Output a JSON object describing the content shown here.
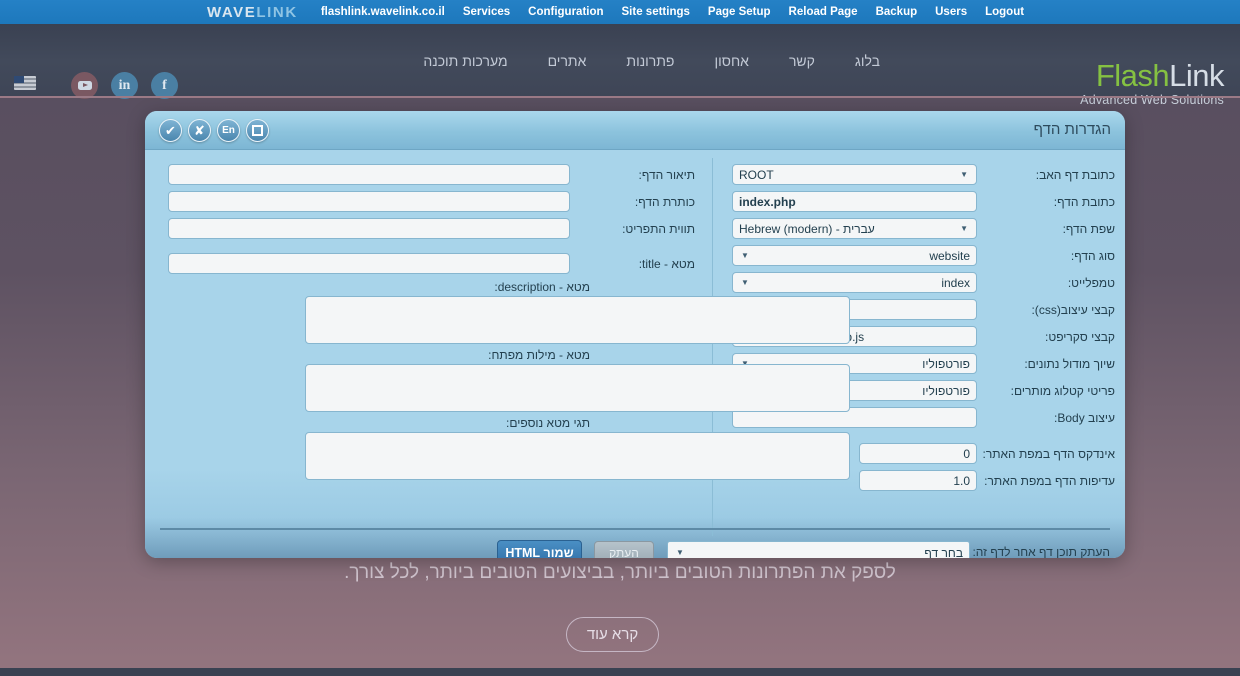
{
  "admin_bar": {
    "logo_part1": "WAVE",
    "logo_part2": "LINK",
    "domain": "flashlink.wavelink.co.il",
    "links": [
      {
        "label": "Services"
      },
      {
        "label": "Configuration"
      },
      {
        "label": "Site settings"
      },
      {
        "label": "Page Setup"
      },
      {
        "label": "Reload Page"
      },
      {
        "label": "Backup"
      },
      {
        "label": "Users"
      },
      {
        "label": "Logout"
      }
    ],
    "bg_color": "#2079be"
  },
  "site_header": {
    "icons": [
      {
        "name": "us-flag-icon"
      },
      {
        "name": "youtube-icon"
      },
      {
        "name": "linkedin-icon",
        "glyph": "in"
      },
      {
        "name": "facebook-icon",
        "glyph": "f"
      }
    ],
    "nav_items": [
      {
        "label": "מערכות תוכנה"
      },
      {
        "label": "אתרים"
      },
      {
        "label": "פתרונות"
      },
      {
        "label": "אחסון"
      },
      {
        "label": "קשר"
      },
      {
        "label": "בלוג"
      }
    ],
    "logo": {
      "part1": "Flash",
      "part2": "Link",
      "tagline": "Advanced Web Solutions",
      "part1_color": "#85c142",
      "part2_color": "#d6dde6"
    }
  },
  "panel": {
    "title": "הגדרות הדף",
    "toolbar": [
      {
        "name": "confirm-button",
        "glyph": "✔"
      },
      {
        "name": "cancel-button",
        "glyph": "✘"
      },
      {
        "name": "language-button",
        "glyph": "En"
      },
      {
        "name": "expand-button",
        "glyph": ""
      }
    ],
    "left_column": {
      "page_description_label": "תיאור הדף:",
      "page_description_value": "",
      "page_heading_label": "כותרת הדף:",
      "page_heading_value": "",
      "menu_label_label": "תווית התפריט:",
      "menu_label_value": "",
      "meta_title_label": "מטא - title:",
      "meta_title_value": "",
      "meta_description_label": "מטא - description:",
      "meta_description_value": "",
      "meta_keywords_label": "מטא - מילות מפתח:",
      "meta_keywords_value": "",
      "extra_meta_label": "תגי מטא נוספים:",
      "extra_meta_value": ""
    },
    "right_column": {
      "parent_page_label": "כתובת דף האב:",
      "parent_page_value": "ROOT",
      "page_address_label": "כתובת הדף:",
      "page_address_value": "index.php",
      "page_language_label": "שפת הדף:",
      "page_language_value": "Hebrew (modern) - עברית",
      "page_type_label": "סוג הדף:",
      "page_type_value": "website",
      "template_label": "טמפלייט:",
      "template_value": "index",
      "css_files_label": "קבצי עיצוב(css):",
      "css_files_value": "",
      "script_files_label": "קבצי סקריפט:",
      "script_files_value": "scripts/jquery.knob.js",
      "data_module_label": "שיוך מודול נתונים:",
      "data_module_value": "פורטפוליו",
      "catalog_items_label": "פריטי קטלוג מותרים:",
      "catalog_items_value": "פורטפוליו",
      "body_style_label": "עיצוב Body:",
      "body_style_value": "",
      "sitemap_index_label": "אינדקס הדף במפת האתר:",
      "sitemap_index_value": "0",
      "sitemap_priority_label": "עדיפות הדף במפת האתר:",
      "sitemap_priority_value": "1.0"
    },
    "actions": {
      "copy_from_page_label": "העתק תוכן דף אחר לדף זה:",
      "page_picker_value": "בחר דף",
      "copy_button_label": "העתק",
      "save_button_label": "שמור HTML"
    }
  },
  "hero": {
    "text": "לספק את הפתרונות הטובים ביותר, בביצועים הטובים ביותר, לכל צורך.",
    "read_more_label": "קרא עוד"
  }
}
